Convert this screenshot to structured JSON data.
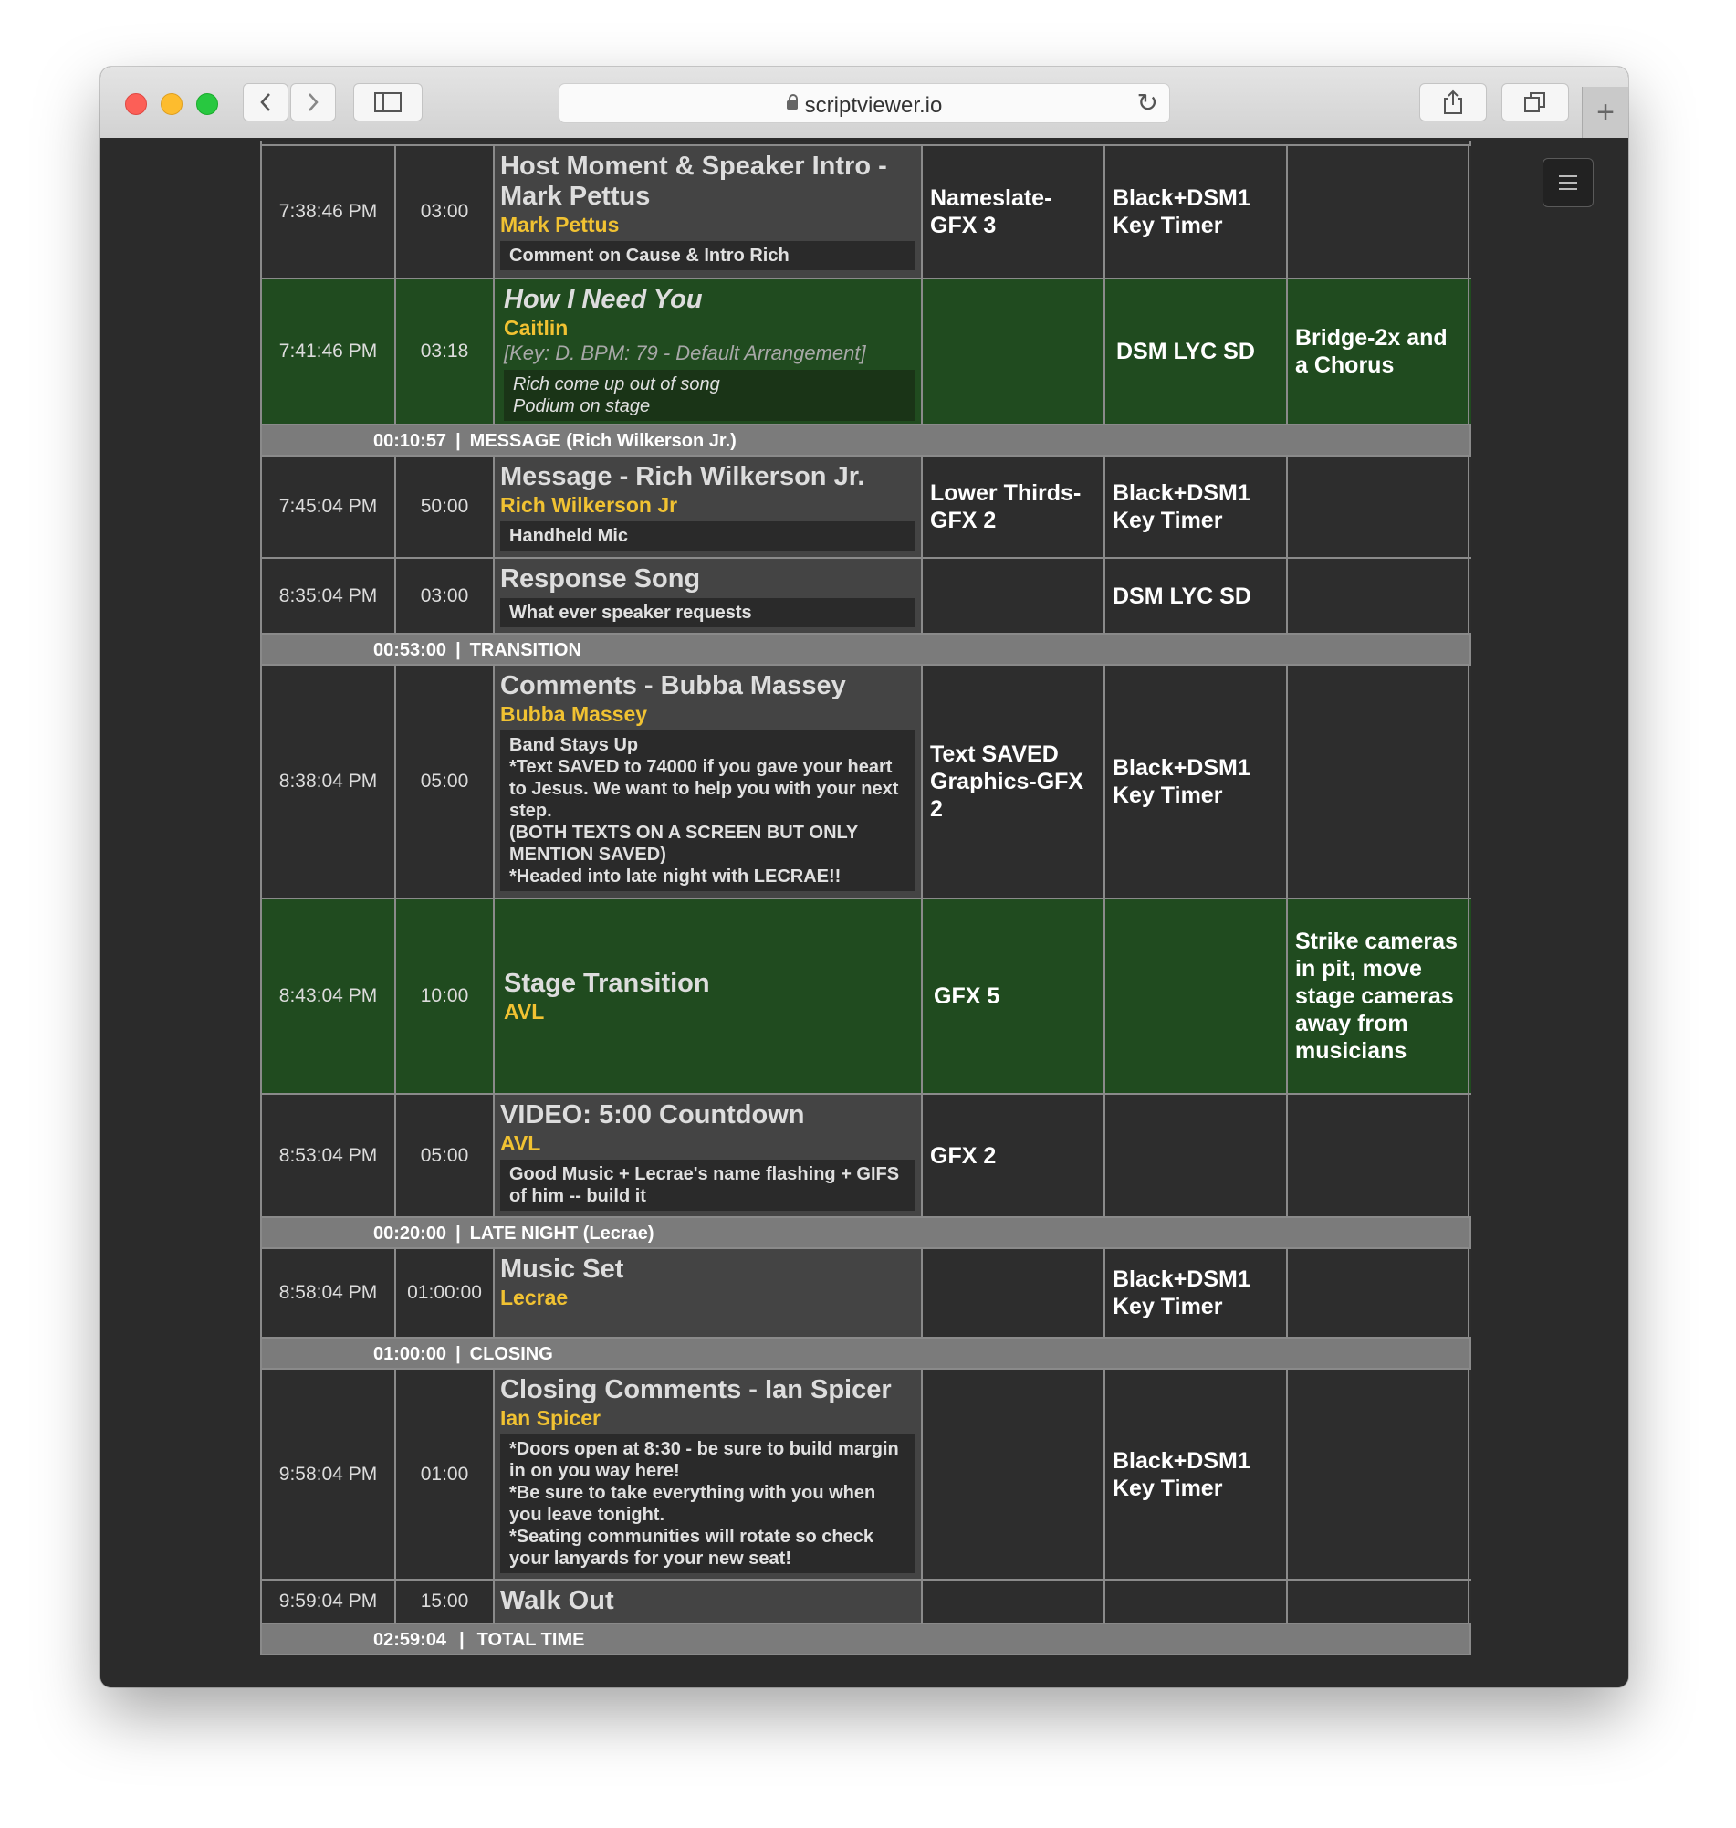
{
  "browser": {
    "url": "scriptviewer.io"
  },
  "sections": {
    "message": {
      "time": "00:10:57",
      "label": "MESSAGE (Rich Wilkerson Jr.)"
    },
    "transition": {
      "time": "00:53:00",
      "label": "TRANSITION"
    },
    "late_night": {
      "time": "00:20:00",
      "label": "LATE NIGHT (Lecrae)"
    },
    "closing": {
      "time": "01:00:00",
      "label": "CLOSING"
    },
    "total": {
      "time": "02:59:04",
      "label": "TOTAL TIME"
    }
  },
  "rows": [
    {
      "start": "7:38:46 PM",
      "length": "03:00",
      "title": "Host Moment & Speaker Intro - Mark Pettus",
      "person": "Mark Pettus",
      "note": "Comment on Cause & Intro Rich",
      "col1": "Nameslate-GFX 3",
      "col2": "Black+DSM1 Key Timer",
      "col3": ""
    },
    {
      "start": "7:41:46 PM",
      "length": "03:18",
      "title": "How I Need You",
      "person": "Caitlin",
      "arrangement": "[Key: D. BPM: 79 - Default Arrangement]",
      "note": "Rich come up out of song\nPodium on stage",
      "col1": "",
      "col2": "DSM LYC SD",
      "col3": "Bridge-2x and a Chorus"
    },
    {
      "start": "7:45:04 PM",
      "length": "50:00",
      "title": "Message - Rich Wilkerson Jr.",
      "person": "Rich Wilkerson Jr",
      "note": "Handheld Mic",
      "col1": "Lower Thirds-GFX 2",
      "col2": "Black+DSM1 Key Timer",
      "col3": ""
    },
    {
      "start": "8:35:04 PM",
      "length": "03:00",
      "title": "Response Song",
      "note": "What ever speaker requests",
      "col1": "",
      "col2": "DSM LYC SD",
      "col3": ""
    },
    {
      "start": "8:38:04 PM",
      "length": "05:00",
      "title": "Comments - Bubba Massey",
      "person": "Bubba Massey",
      "note": "Band Stays Up\n*Text SAVED to 74000 if you gave your heart to Jesus. We want to help you with your next step.\n(BOTH TEXTS ON A SCREEN BUT ONLY MENTION SAVED)\n*Headed into late night with LECRAE!!",
      "col1": "Text SAVED Graphics-GFX 2",
      "col2": "Black+DSM1 Key Timer",
      "col3": ""
    },
    {
      "start": "8:43:04 PM",
      "length": "10:00",
      "title": "Stage Transition",
      "person": "AVL",
      "col1": "GFX 5",
      "col2": "",
      "col3": "Strike cameras in pit, move stage cameras away from musicians"
    },
    {
      "start": "8:53:04 PM",
      "length": "05:00",
      "title": "VIDEO: 5:00 Countdown",
      "person": "AVL",
      "note": "Good Music + Lecrae's name flashing + GIFS of him -- build it",
      "col1": "GFX 2",
      "col2": "",
      "col3": ""
    },
    {
      "start": "8:58:04 PM",
      "length": "01:00:00",
      "title": "Music Set",
      "person": "Lecrae",
      "col1": "",
      "col2": "Black+DSM1 Key Timer",
      "col3": ""
    },
    {
      "start": "9:58:04 PM",
      "length": "01:00",
      "title": "Closing Comments - Ian Spicer",
      "person": "Ian Spicer",
      "note": "*Doors open at 8:30 - be sure to build margin in on you way here!\n*Be sure to take everything with you when you leave tonight.\n*Seating communities will rotate so check your lanyards for your new seat!",
      "col1": "",
      "col2": "Black+DSM1 Key Timer",
      "col3": ""
    },
    {
      "start": "9:59:04 PM",
      "length": "15:00",
      "title": "Walk Out",
      "col1": "",
      "col2": "",
      "col3": ""
    }
  ]
}
